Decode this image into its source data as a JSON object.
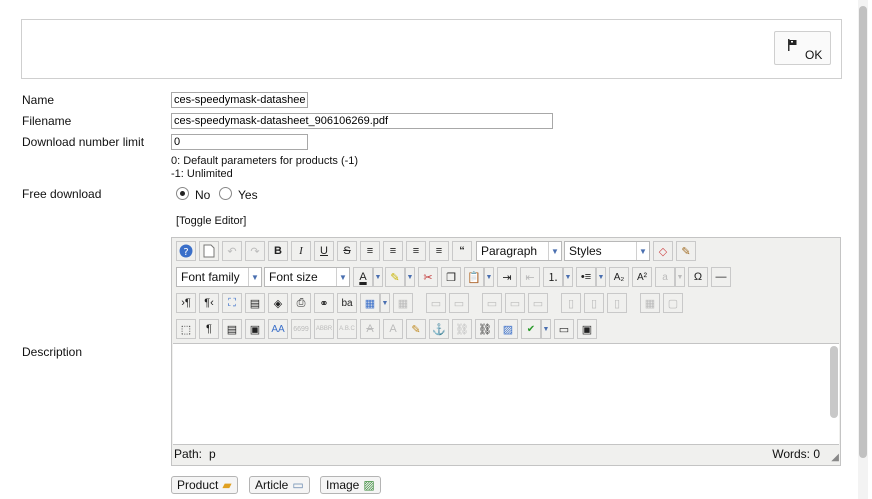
{
  "ok_button": {
    "label": "OK"
  },
  "form": {
    "name_label": "Name",
    "name_value": "ces-speedymask-datasheet",
    "filename_label": "Filename",
    "filename_value": "ces-speedymask-datasheet_906106269.pdf",
    "limit_label": "Download number limit",
    "limit_value": "0",
    "limit_hint1": "0: Default parameters for products (-1)",
    "limit_hint2": "-1: Unlimited",
    "free_label": "Free download",
    "free_no": "No",
    "free_yes": "Yes",
    "free_selected": "No",
    "toggle_editor": "[Toggle Editor]",
    "description_label": "Description"
  },
  "editor": {
    "format_select": "Paragraph",
    "styles_select": "Styles",
    "font_family_select": "Font family",
    "font_size_select": "Font size",
    "path_label": "Path:",
    "path_value": "p",
    "words_label": "Words: 0"
  },
  "bottom_buttons": {
    "product": "Product",
    "article": "Article",
    "image": "Image"
  },
  "colors": {
    "accent_blue": "#3a6fc9",
    "editor_bg": "#f0f0ee",
    "border": "#cfcfcf"
  }
}
